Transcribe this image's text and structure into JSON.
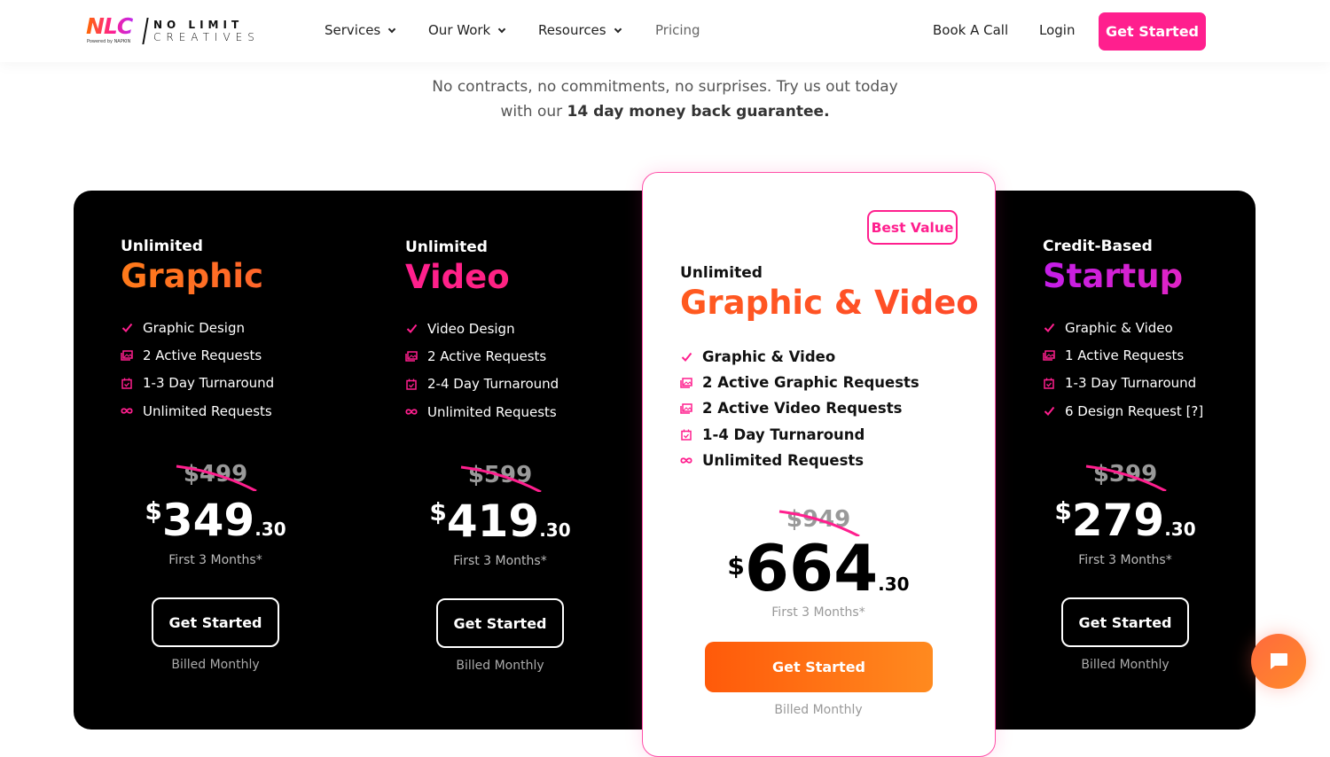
{
  "nav": {
    "logo_mark": "NLC",
    "logo_powered": "Powered by NAPKIN",
    "logo_line1": "NO LIMIT",
    "logo_line2": "CREATIVES",
    "items": [
      {
        "label": "Services"
      },
      {
        "label": "Our Work"
      },
      {
        "label": "Resources"
      },
      {
        "label": "Pricing"
      }
    ],
    "book": "Book A Call",
    "login": "Login",
    "cta": "Get Started"
  },
  "intro": {
    "line1": "No contracts, no commitments, no surprises. Try us out today",
    "line2_pre": "with our ",
    "line2_bold": "14 day money back guarantee."
  },
  "colors": {
    "pink": "#ff1f8e",
    "orange": "#ff6a13",
    "purple": "#c41ee8"
  },
  "plans": [
    {
      "eyebrow": "Unlimited",
      "title": "Graphic",
      "features": [
        {
          "icon": "check-icon",
          "text": "Graphic Design"
        },
        {
          "icon": "images-icon",
          "text": "2 Active Requests"
        },
        {
          "icon": "calendar-icon",
          "text": "1-3 Day Turnaround"
        },
        {
          "icon": "infinity-icon",
          "text": "Unlimited Requests"
        }
      ],
      "old_price": "$499",
      "currency": "$",
      "price": "349",
      "cents": ".30",
      "note": "First 3 Months*",
      "button": "Get Started",
      "billing": "Billed Monthly"
    },
    {
      "eyebrow": "Unlimited",
      "title": "Video",
      "features": [
        {
          "icon": "check-icon",
          "text": "Video Design"
        },
        {
          "icon": "images-icon",
          "text": "2 Active Requests"
        },
        {
          "icon": "calendar-icon",
          "text": "2-4 Day Turnaround"
        },
        {
          "icon": "infinity-icon",
          "text": "Unlimited Requests"
        }
      ],
      "old_price": "$599",
      "currency": "$",
      "price": "419",
      "cents": ".30",
      "note": "First 3 Months*",
      "button": "Get Started",
      "billing": "Billed Monthly"
    },
    {
      "badge": "Best Value",
      "eyebrow": "Unlimited",
      "title": "Graphic & Video",
      "features": [
        {
          "icon": "check-icon",
          "text": "Graphic & Video"
        },
        {
          "icon": "images-icon",
          "text": "2 Active Graphic Requests"
        },
        {
          "icon": "images-icon",
          "text": "2 Active Video Requests"
        },
        {
          "icon": "calendar-icon",
          "text": "1-4 Day Turnaround"
        },
        {
          "icon": "infinity-icon",
          "text": "Unlimited Requests"
        }
      ],
      "old_price": "$949",
      "currency": "$",
      "price": "664",
      "cents": ".30",
      "note": "First 3 Months*",
      "button": "Get Started",
      "billing": "Billed Monthly"
    },
    {
      "eyebrow": "Credit-Based",
      "title": "Startup",
      "features": [
        {
          "icon": "check-icon",
          "text": "Graphic & Video"
        },
        {
          "icon": "images-icon",
          "text": "1 Active Requests"
        },
        {
          "icon": "calendar-icon",
          "text": "1-3 Day Turnaround"
        },
        {
          "icon": "check-icon",
          "text": "6 Design Request [?]"
        }
      ],
      "old_price": "$399",
      "currency": "$",
      "price": "279",
      "cents": ".30",
      "note": "First 3 Months*",
      "button": "Get Started",
      "billing": "Billed Monthly"
    }
  ]
}
